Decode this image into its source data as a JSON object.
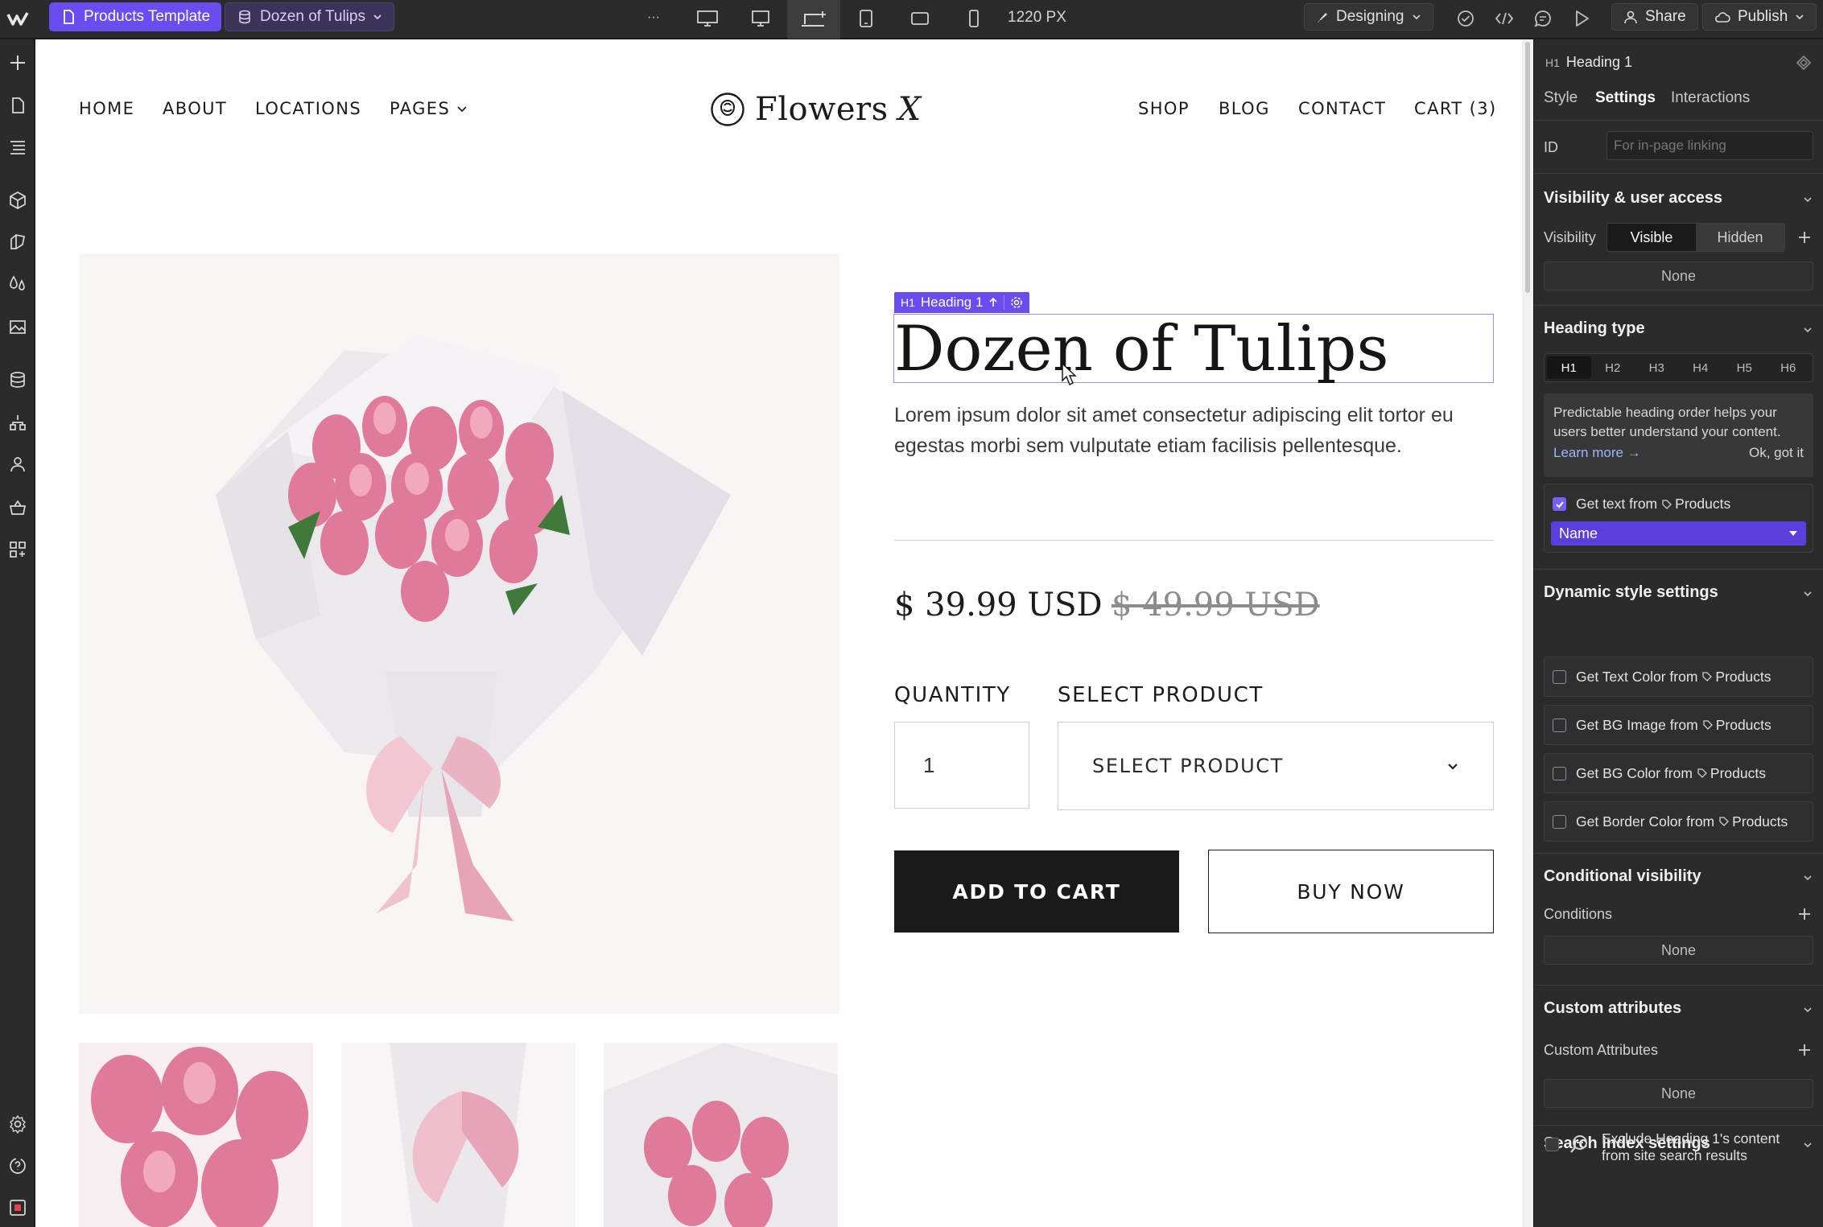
{
  "topbar": {
    "page_label": "Products Template",
    "item_label": "Dozen of Tulips",
    "more": "···",
    "width_readout": "1220 PX",
    "mode_label": "Designing",
    "share_label": "Share",
    "publish_label": "Publish",
    "icons": [
      "webflow-logo",
      "page-icon",
      "cms-item-icon",
      "more-icon",
      "desktop-xl-icon",
      "desktop-large-icon",
      "desktop-base-icon",
      "tablet-icon",
      "mobile-landscape-icon",
      "mobile-portrait-icon",
      "checkmark-icon",
      "code-icon",
      "comment-icon",
      "preview-play-icon",
      "person-icon",
      "cloud-icon"
    ]
  },
  "left_toolbar": {
    "icons": [
      "add-icon",
      "pages-icon",
      "navigator-icon",
      "components-icon",
      "style-selector-icon",
      "variables-icon",
      "assets-icon",
      "cms-icon",
      "logic-icon",
      "users-icon",
      "ecommerce-icon",
      "apps-icon",
      "settings-icon",
      "help-icon",
      "record-icon"
    ]
  },
  "site": {
    "nav_left": [
      "HOME",
      "ABOUT",
      "LOCATIONS",
      "PAGES"
    ],
    "logo_text": "Flowers",
    "logo_mark": "X",
    "nav_right": [
      "SHOP",
      "BLOG",
      "CONTACT",
      "CART (3)"
    ],
    "selection_badge": {
      "tag": "H1",
      "label": "Heading 1"
    },
    "product_title": "Dozen of Tulips",
    "product_desc": "Lorem ipsum dolor sit amet consectetur adipiscing elit tortor eu egestas morbi sem vulputate etiam facilisis pellentesque.",
    "price": "$ 39.99 USD",
    "compare_price": "$ 49.99 USD",
    "quantity_label": "QUANTITY",
    "quantity_value": "1",
    "select_label": "SELECT PRODUCT",
    "select_value": "SELECT PRODUCT",
    "add_to_cart": "ADD TO CART",
    "buy_now": "BUY NOW"
  },
  "panel": {
    "element_tag": "H1",
    "element_name": "Heading 1",
    "tabs": [
      "Style",
      "Settings",
      "Interactions"
    ],
    "active_tab": "Settings",
    "id_label": "ID",
    "id_placeholder": "For in-page linking",
    "visibility_section": "Visibility & user access",
    "visibility_label": "Visibility",
    "visibility_options": [
      "Visible",
      "Hidden"
    ],
    "visibility_none": "None",
    "heading_type_section": "Heading type",
    "heading_levels": [
      "H1",
      "H2",
      "H3",
      "H4",
      "H5",
      "H6"
    ],
    "hint_text": "Predictable heading order helps your users better understand your content.",
    "learn_more": "Learn more →",
    "ok_got_it": "Ok, got it",
    "get_text_from": "Get text from",
    "collection": "Products",
    "field_value": "Name",
    "dynamic_section": "Dynamic style settings",
    "dynamic_items": [
      "Get Text Color from",
      "Get BG Image from",
      "Get BG Color from",
      "Get Border Color from"
    ],
    "conditional_section": "Conditional visibility",
    "conditions_label": "Conditions",
    "conditions_none": "None",
    "custom_attr_section": "Custom attributes",
    "custom_attr_label": "Custom Attributes",
    "custom_attr_none": "None",
    "search_section": "Search index settings",
    "search_exclude": "Exclude Heading 1's content from site search results"
  },
  "colors": {
    "accent": "#6a4cf0",
    "panel_bg": "#2b2b2b",
    "toolbar_bg": "#2b2b2b",
    "dropdown_bg": "#5b3fdc",
    "checkbox_checked": "#7a5cff",
    "selection_outline": "#a58cf5",
    "product_bg": "#f8f4f4"
  }
}
